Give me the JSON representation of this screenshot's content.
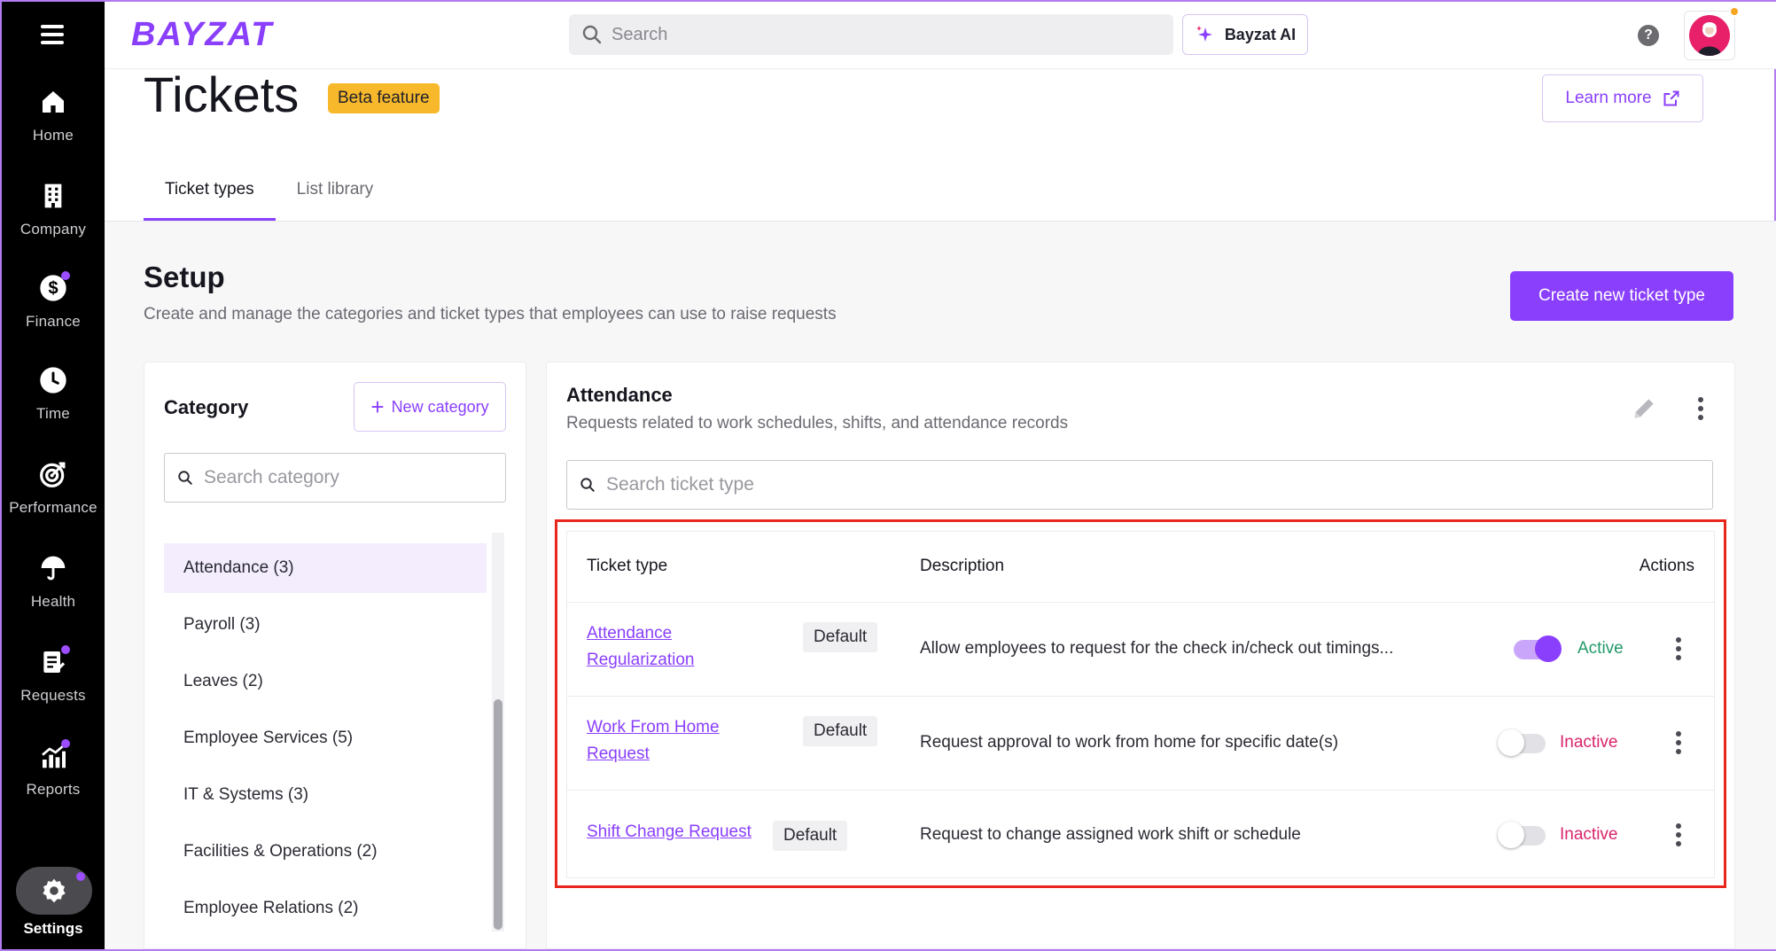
{
  "nav": {
    "items": [
      {
        "label": "Home",
        "icon": "home-icon"
      },
      {
        "label": "Company",
        "icon": "building-icon"
      },
      {
        "label": "Finance",
        "icon": "dollar-icon"
      },
      {
        "label": "Time",
        "icon": "clock-icon"
      },
      {
        "label": "Performance",
        "icon": "target-icon"
      },
      {
        "label": "Health",
        "icon": "umbrella-icon"
      },
      {
        "label": "Requests",
        "icon": "clipboard-icon"
      },
      {
        "label": "Reports",
        "icon": "chart-icon"
      }
    ],
    "settings_label": "Settings"
  },
  "topbar": {
    "logo": "BAYZAT",
    "search_placeholder": "Search",
    "ai_label": "Bayzat AI",
    "help": "?"
  },
  "header": {
    "title": "Tickets",
    "beta_badge": "Beta feature",
    "learn_more": "Learn more"
  },
  "tabs": [
    {
      "label": "Ticket types",
      "active": true
    },
    {
      "label": "List library",
      "active": false
    }
  ],
  "setup": {
    "title": "Setup",
    "subtitle": "Create and manage the categories and ticket types that employees can use to raise requests",
    "create_button": "Create new ticket type"
  },
  "category": {
    "title": "Category",
    "new_button": "New category",
    "search_placeholder": "Search category",
    "items": [
      {
        "label": "Attendance (3)"
      },
      {
        "label": "Payroll (3)"
      },
      {
        "label": "Leaves (2)"
      },
      {
        "label": "Employee Services (5)"
      },
      {
        "label": "IT & Systems (3)"
      },
      {
        "label": "Facilities & Operations (2)"
      },
      {
        "label": "Employee Relations (2)"
      }
    ]
  },
  "ticket_panel": {
    "title": "Attendance",
    "subtitle": "Requests related to work schedules, shifts, and attendance records",
    "search_placeholder": "Search ticket type",
    "columns": {
      "type": "Ticket type",
      "description": "Description",
      "actions": "Actions"
    },
    "rows": [
      {
        "name_line1": "Attendance",
        "name_line2": "Regularization",
        "badge": "Default",
        "description": "Allow employees to request for the check in/check out timings...",
        "enabled": true,
        "status": "Active"
      },
      {
        "name_line1": "Work From Home",
        "name_line2": "Request",
        "badge": "Default",
        "description": "Request approval to work from home for specific date(s)",
        "enabled": false,
        "status": "Inactive"
      },
      {
        "name_line1": "Shift Change Request",
        "name_line2": "",
        "badge": "Default",
        "description": "Request to change assigned work shift or schedule",
        "enabled": false,
        "status": "Inactive"
      }
    ]
  },
  "colors": {
    "accent": "#8a3ffc",
    "active": "#229a6b",
    "inactive": "#d9246a",
    "beta": "#f7b92b",
    "highlight": "#e8261c"
  }
}
